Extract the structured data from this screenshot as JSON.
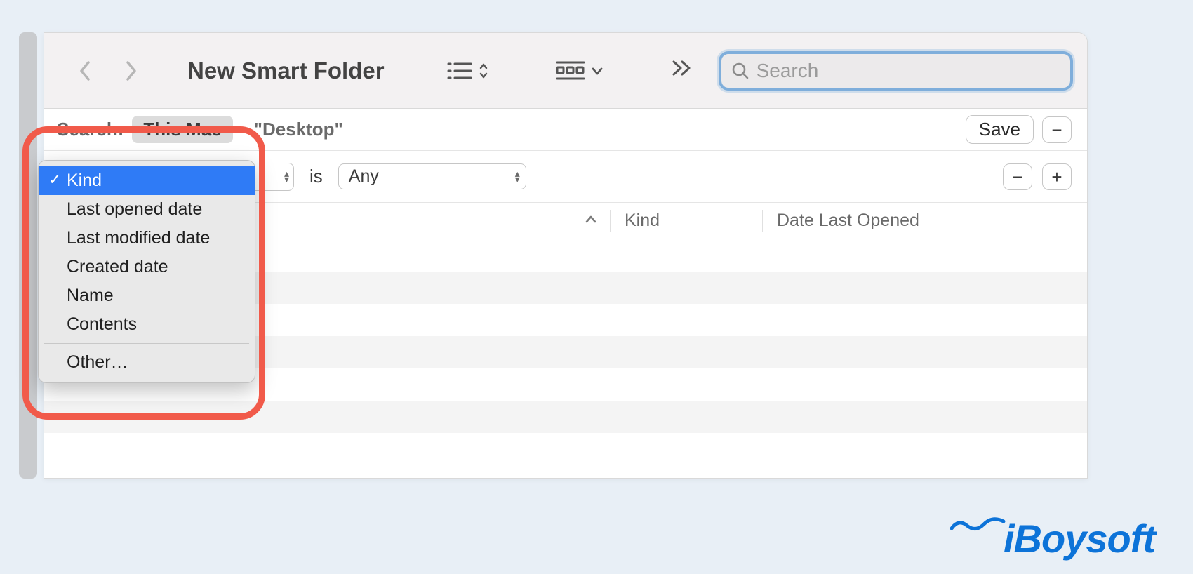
{
  "toolbar": {
    "title": "New Smart Folder"
  },
  "search": {
    "placeholder": "Search",
    "value": ""
  },
  "scope": {
    "label": "Search:",
    "active_scope": "This Mac",
    "location": "\"Desktop\"",
    "save_label": "Save"
  },
  "criteria": {
    "attribute_visible": "",
    "operator": "is",
    "value_select": "Any"
  },
  "columns": {
    "kind": "Kind",
    "date_last_opened": "Date Last Opened"
  },
  "dropdown": {
    "items": [
      {
        "label": "Kind",
        "selected": true
      },
      {
        "label": "Last opened date",
        "selected": false
      },
      {
        "label": "Last modified date",
        "selected": false
      },
      {
        "label": "Created date",
        "selected": false
      },
      {
        "label": "Name",
        "selected": false
      },
      {
        "label": "Contents",
        "selected": false
      }
    ],
    "other_label": "Other…"
  },
  "watermark": "iBoysoft"
}
